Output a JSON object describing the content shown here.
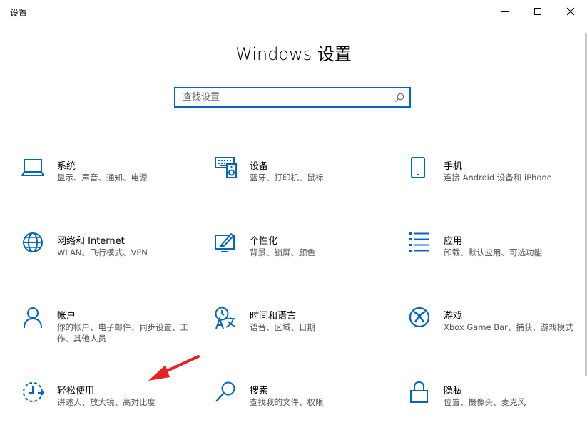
{
  "window": {
    "title": "设置",
    "controls": [
      "minimize-icon",
      "maximize-icon",
      "close-icon"
    ]
  },
  "page": {
    "title": "Windows 设置"
  },
  "search": {
    "placeholder": "查找设置",
    "value": ""
  },
  "colors": {
    "accent": "#0067c0",
    "annotation_arrow": "#e8231f"
  },
  "categories": [
    {
      "name": "系统",
      "desc": "显示、声音、通知、电源",
      "icon": "laptop-icon"
    },
    {
      "name": "设备",
      "desc": "蓝牙、打印机、鼠标",
      "icon": "devices-icon"
    },
    {
      "name": "手机",
      "desc": "连接 Android 设备和 iPhone",
      "icon": "phone-icon"
    },
    {
      "name": "网络和 Internet",
      "desc": "WLAN、飞行模式、VPN",
      "icon": "globe-icon"
    },
    {
      "name": "个性化",
      "desc": "背景、锁屏、颜色",
      "icon": "personalization-icon"
    },
    {
      "name": "应用",
      "desc": "卸载、默认应用、可选功能",
      "icon": "apps-list-icon"
    },
    {
      "name": "帐户",
      "desc": "你的帐户、电子邮件、同步设置、工作、其他人员",
      "icon": "person-icon"
    },
    {
      "name": "时间和语言",
      "desc": "语音、区域、日期",
      "icon": "time-language-icon"
    },
    {
      "name": "游戏",
      "desc": "Xbox Game Bar、捕获、游戏模式",
      "icon": "xbox-icon"
    },
    {
      "name": "轻松使用",
      "desc": "讲述人、放大镜、高对比度",
      "icon": "ease-of-access-icon"
    },
    {
      "name": "搜索",
      "desc": "查找我的文件、权限",
      "icon": "search-magnifier-icon"
    },
    {
      "name": "隐私",
      "desc": "位置、摄像头、麦克风",
      "icon": "lock-icon"
    }
  ]
}
